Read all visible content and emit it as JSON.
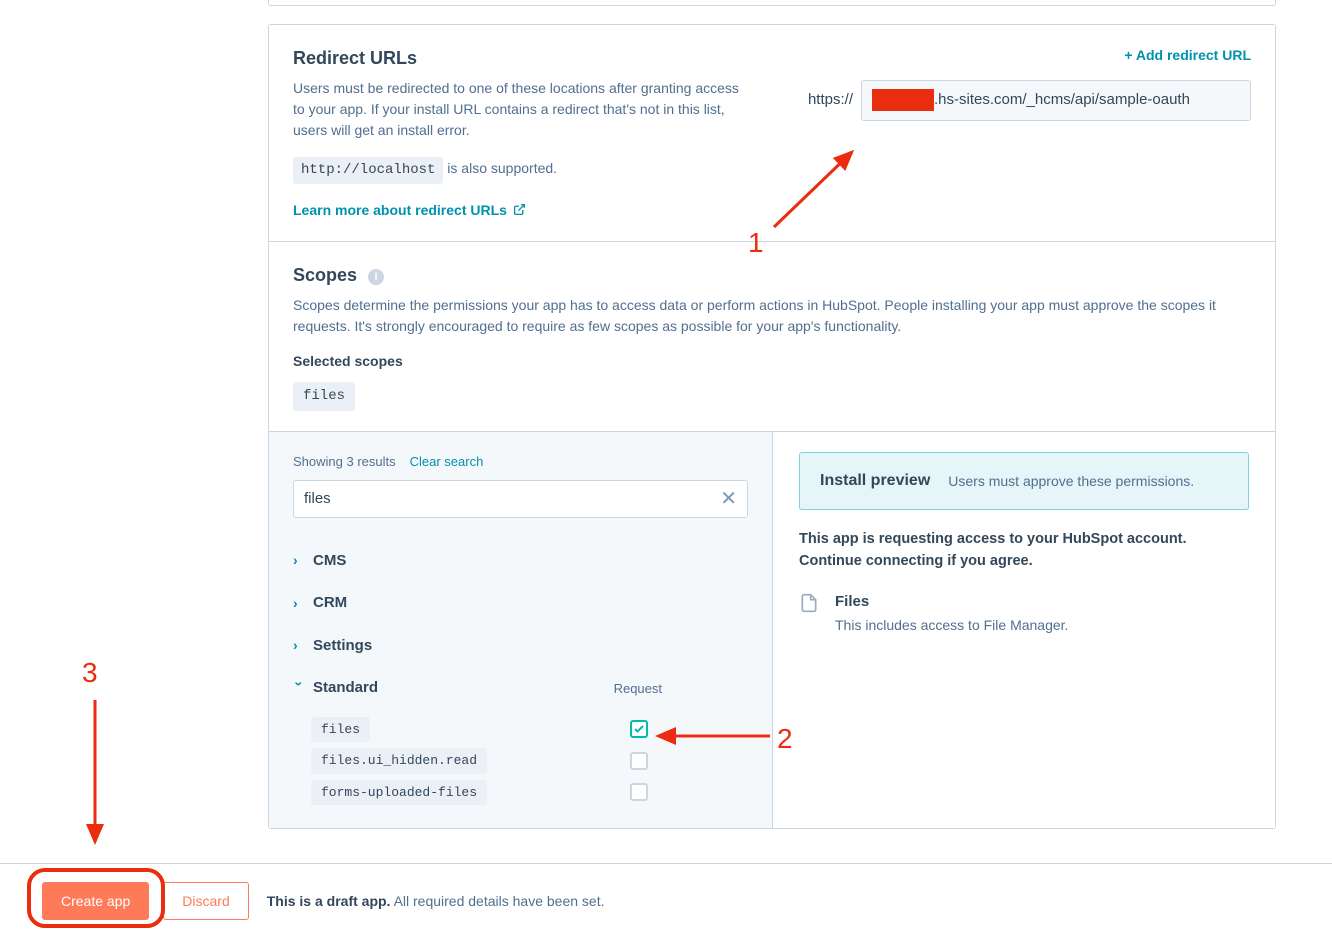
{
  "redirect": {
    "title": "Redirect URLs",
    "desc": "Users must be redirected to one of these locations after granting access to your app. If your install URL contains a redirect that's not in this list, users will get an install error.",
    "localhost_code": "http://localhost",
    "localhost_suffix": " is also supported.",
    "learn_more": "Learn more about redirect URLs",
    "add_link": "+ Add redirect URL",
    "url_prefix": "https://",
    "url_suffix": ".hs-sites.com/_hcms/api/sample-oauth"
  },
  "scopes": {
    "title": "Scopes",
    "desc": "Scopes determine the permissions your app has to access data or perform actions in HubSpot. People installing your app must approve the scopes it requests. It's strongly encouraged to require as few scopes as possible for your app's functionality.",
    "selected_label": "Selected scopes",
    "selected": "files"
  },
  "search": {
    "results_text": "Showing 3 results",
    "clear_label": "Clear search",
    "value": "files"
  },
  "categories": {
    "cms": "CMS",
    "crm": "CRM",
    "settings": "Settings",
    "standard": "Standard",
    "request_head": "Request"
  },
  "scope_items": [
    {
      "name": "files",
      "checked": true
    },
    {
      "name": "files.ui_hidden.read",
      "checked": false
    },
    {
      "name": "forms-uploaded-files",
      "checked": false
    }
  ],
  "preview": {
    "title": "Install preview",
    "subtitle": "Users must approve these permissions.",
    "access_text": "This app is requesting access to your HubSpot account. Continue connecting if you agree.",
    "perm_name": "Files",
    "perm_desc": "This includes access to File Manager."
  },
  "footer": {
    "create": "Create app",
    "discard": "Discard",
    "draft_bold": "This is a draft app.",
    "draft_rest": " All required details have been set."
  },
  "annotations": {
    "one": "1",
    "two": "2",
    "three": "3"
  }
}
